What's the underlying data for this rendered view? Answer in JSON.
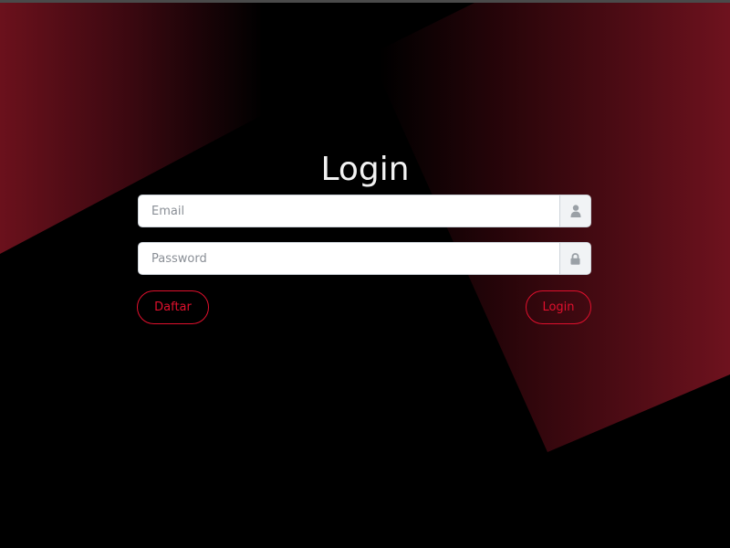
{
  "title": "Login",
  "form": {
    "email": {
      "placeholder": "Email",
      "value": "",
      "icon": "user-icon"
    },
    "password": {
      "placeholder": "Password",
      "value": "",
      "icon": "lock-icon"
    }
  },
  "buttons": {
    "register_label": "Daftar",
    "login_label": "Login"
  },
  "colors": {
    "background": "#000000",
    "accent": "#e0102d",
    "gradient_red": "#6e121e",
    "title_text": "#f2f2f2"
  }
}
